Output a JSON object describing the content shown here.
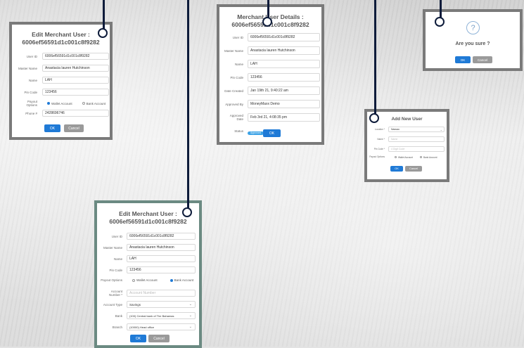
{
  "edit1": {
    "title_line1": "Edit Merchant User :",
    "title_line2": "6006ef56591d1c001c8f9282",
    "fields": [
      {
        "label": "User ID",
        "value": "6006ef56591d1c001c8f9282"
      },
      {
        "label": "Master Name",
        "value": "Anastacia lauren Hutchinson"
      },
      {
        "label": "Name",
        "value": "LAH"
      },
      {
        "label": "Pin Code",
        "value": "123456"
      }
    ],
    "payout_label": "Payout Options",
    "payout_options": [
      "Wallet Account",
      "Bank Account"
    ],
    "phone_label": "Phone #",
    "phone_value": "2428696746",
    "ok": "OK",
    "cancel": "Cancel"
  },
  "details": {
    "title_line1": "Merchant User Details :",
    "title_line2": "6006ef56591d1c001c8f9282",
    "fields": [
      {
        "label": "User ID",
        "value": "6006ef56591d1c001c8f9282"
      },
      {
        "label": "Master Name",
        "value": "Anastacia lauren Hutchinson"
      },
      {
        "label": "Name",
        "value": "LAH"
      },
      {
        "label": "Pin Code",
        "value": "123456"
      },
      {
        "label": "Date Created",
        "value": "Jan 19th 21, 9:40:22 am"
      },
      {
        "label": "Approved By",
        "value": "MoneyMaxx Demo"
      },
      {
        "label": "Approved Date",
        "value": "Feb 3rd 21, 4:08:35 pm"
      }
    ],
    "status_label": "Status",
    "status_value": "Approved",
    "ok": "OK"
  },
  "confirm": {
    "icon": "?",
    "title": "Are you sure ?",
    "ok": "OK",
    "cancel": "Cancel"
  },
  "add": {
    "title": "Add New User",
    "location_label": "Location *",
    "location_value": "Nassau",
    "name_label": "Name *",
    "name_placeholder": "Name",
    "pin_label": "Pin Code *",
    "pin_placeholder": "4 Digit Code",
    "payout_label": "Payout Options",
    "payout_options": [
      "Wallet Account",
      "Bank Account"
    ],
    "ok": "OK",
    "cancel": "Cancel"
  },
  "edit2": {
    "title_line1": "Edit Merchant User :",
    "title_line2": "6006ef56591d1c001c8f9282",
    "fields": [
      {
        "label": "User ID",
        "value": "6006ef56591d1c001c8f9282"
      },
      {
        "label": "Master Name",
        "value": "Anastacia lauren Hutchinson"
      },
      {
        "label": "Name",
        "value": "LAH"
      },
      {
        "label": "Pin Code",
        "value": "123456"
      }
    ],
    "payout_label": "Payout Options",
    "payout_options": [
      "Wallet Account",
      "Bank Account"
    ],
    "account_number_label": "Account Number *",
    "account_number_placeholder": "Account Number",
    "account_type_label": "Account Type",
    "account_type_value": "Savings",
    "bank_label": "Bank",
    "bank_value": "(100) Central bank of The Bahamas",
    "branch_label": "Branch",
    "branch_value": "(10000) Head office",
    "ok": "OK",
    "cancel": "Cancel"
  }
}
